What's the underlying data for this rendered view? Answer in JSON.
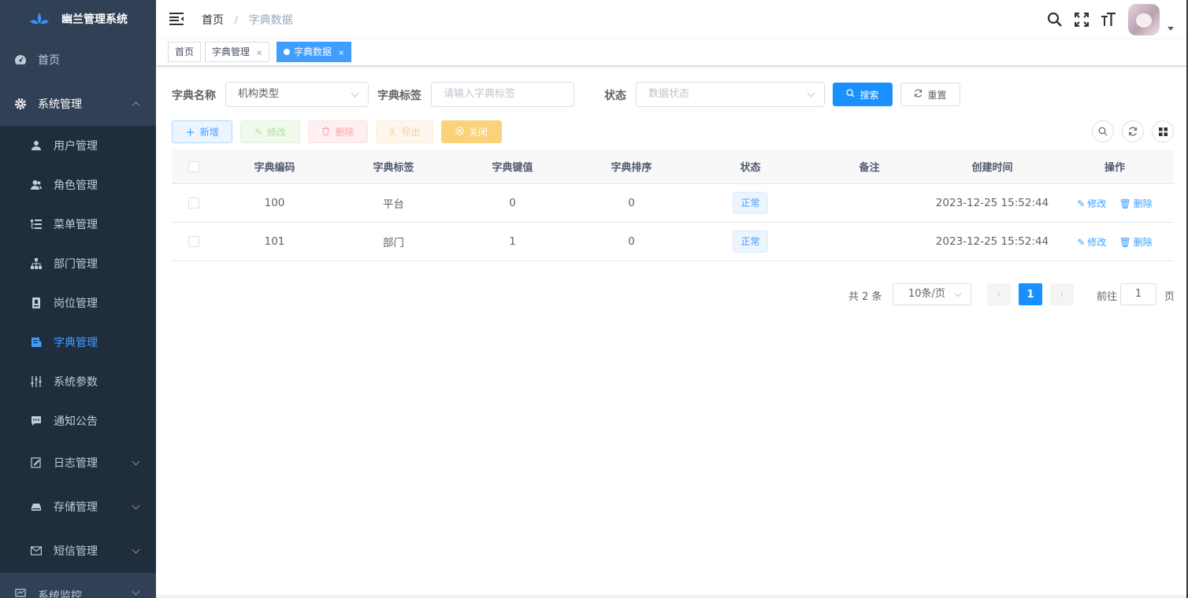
{
  "app": {
    "title": "幽兰管理系统"
  },
  "sidebar": {
    "top_items": [
      {
        "label": "首页",
        "icon": "dashboard-icon"
      },
      {
        "label": "系统管理",
        "icon": "gear-icon"
      }
    ],
    "sub_items": [
      {
        "label": "用户管理",
        "icon": "user-icon"
      },
      {
        "label": "角色管理",
        "icon": "peoples-icon"
      },
      {
        "label": "菜单管理",
        "icon": "tree-table-icon"
      },
      {
        "label": "部门管理",
        "icon": "org-tree-icon"
      },
      {
        "label": "岗位管理",
        "icon": "post-icon"
      },
      {
        "label": "字典管理",
        "icon": "dict-icon",
        "active": true
      },
      {
        "label": "系统参数",
        "icon": "sliders-icon"
      },
      {
        "label": "通知公告",
        "icon": "message-icon"
      },
      {
        "label": "日志管理",
        "icon": "log-icon"
      },
      {
        "label": "存储管理",
        "icon": "storage-icon"
      },
      {
        "label": "短信管理",
        "icon": "mail-icon"
      }
    ],
    "bottom_item": {
      "label": "系统监控",
      "icon": "monitor-icon"
    }
  },
  "navbar": {
    "breadcrumb": [
      "首页",
      "字典数据"
    ],
    "icons": [
      "search-icon",
      "fullscreen-icon",
      "font-size-icon"
    ]
  },
  "tags": [
    {
      "label": "首页"
    },
    {
      "label": "字典管理"
    },
    {
      "label": "字典数据",
      "active": true
    }
  ],
  "search": {
    "dict_name_label": "字典名称",
    "dict_name_value": "机构类型",
    "dict_label_label": "字典标签",
    "dict_label_placeholder": "请输入字典标签",
    "status_label": "状态",
    "status_placeholder": "数据状态",
    "search_btn": "搜索",
    "reset_btn": "重置"
  },
  "toolbar": {
    "add": "新增",
    "edit": "修改",
    "delete": "删除",
    "export": "导出",
    "close": "关闭"
  },
  "table": {
    "columns": [
      "字典编码",
      "字典标签",
      "字典键值",
      "字典排序",
      "状态",
      "备注",
      "创建时间",
      "操作"
    ],
    "rows": [
      {
        "code": "100",
        "label": "平台",
        "value": "0",
        "sort": "0",
        "status": "正常",
        "remark": "",
        "created": "2023-12-25 15:52:44",
        "edit": "修改",
        "delete": "删除"
      },
      {
        "code": "101",
        "label": "部门",
        "value": "1",
        "sort": "0",
        "status": "正常",
        "remark": "",
        "created": "2023-12-25 15:52:44",
        "edit": "修改",
        "delete": "删除"
      }
    ]
  },
  "pagination": {
    "total_text": "共 2 条",
    "page_size": "10条/页",
    "current_page": "1",
    "goto_label": "前往",
    "goto_value": "1",
    "page_suffix": "页"
  },
  "colors": {
    "sidebar": "#304156",
    "primary": "#1890ff",
    "active_menu": "#409eff"
  }
}
